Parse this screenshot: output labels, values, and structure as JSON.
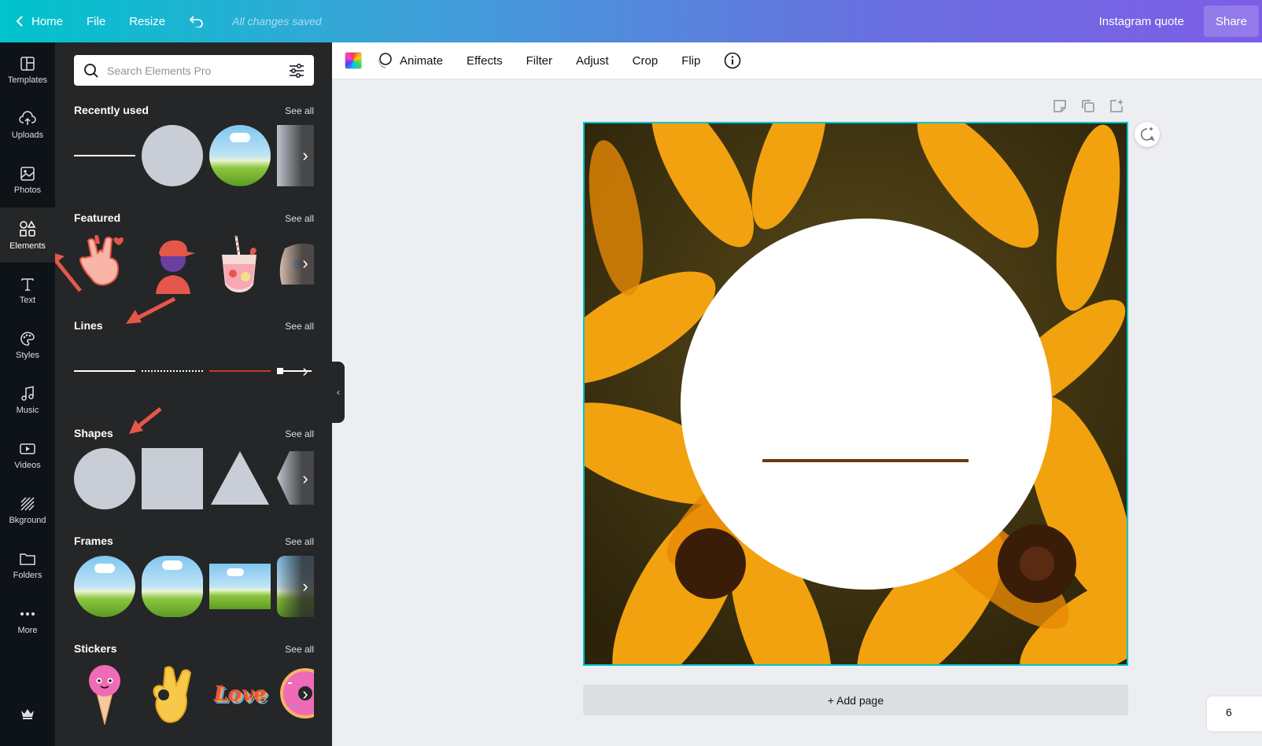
{
  "topbar": {
    "home": "Home",
    "file": "File",
    "resize": "Resize",
    "saved_status": "All changes saved",
    "design_title": "Instagram quote",
    "share": "Share"
  },
  "nav": [
    {
      "label": "Templates",
      "icon": "templates-icon"
    },
    {
      "label": "Uploads",
      "icon": "upload-cloud-icon"
    },
    {
      "label": "Photos",
      "icon": "photo-icon"
    },
    {
      "label": "Elements",
      "icon": "shapes-icon"
    },
    {
      "label": "Text",
      "icon": "text-icon"
    },
    {
      "label": "Styles",
      "icon": "palette-icon"
    },
    {
      "label": "Music",
      "icon": "music-note-icon"
    },
    {
      "label": "Videos",
      "icon": "video-icon"
    },
    {
      "label": "Bkground",
      "icon": "background-hatch-icon"
    },
    {
      "label": "Folders",
      "icon": "folder-icon"
    },
    {
      "label": "More",
      "icon": "more-dots-icon"
    }
  ],
  "active_nav": "Elements",
  "search": {
    "placeholder": "Search Elements Pro"
  },
  "sections": {
    "recent": {
      "title": "Recently used",
      "see_all": "See all"
    },
    "featured": {
      "title": "Featured",
      "see_all": "See all"
    },
    "lines": {
      "title": "Lines",
      "see_all": "See all"
    },
    "shapes": {
      "title": "Shapes",
      "see_all": "See all"
    },
    "frames": {
      "title": "Frames",
      "see_all": "See all"
    },
    "stickers": {
      "title": "Stickers",
      "see_all": "See all"
    }
  },
  "sticker_love_text": "Love",
  "toolbar": {
    "animate": "Animate",
    "effects": "Effects",
    "filter": "Filter",
    "adjust": "Adjust",
    "crop": "Crop",
    "flip": "Flip"
  },
  "canvas": {
    "add_page": "+ Add page",
    "page_number": "6"
  },
  "colors": {
    "accent": "#00c4cc",
    "panel_bg": "#252627",
    "nav_bg": "#0e1318",
    "annotation_arrow": "#e5574a",
    "line_color": "#6b3a0f"
  }
}
